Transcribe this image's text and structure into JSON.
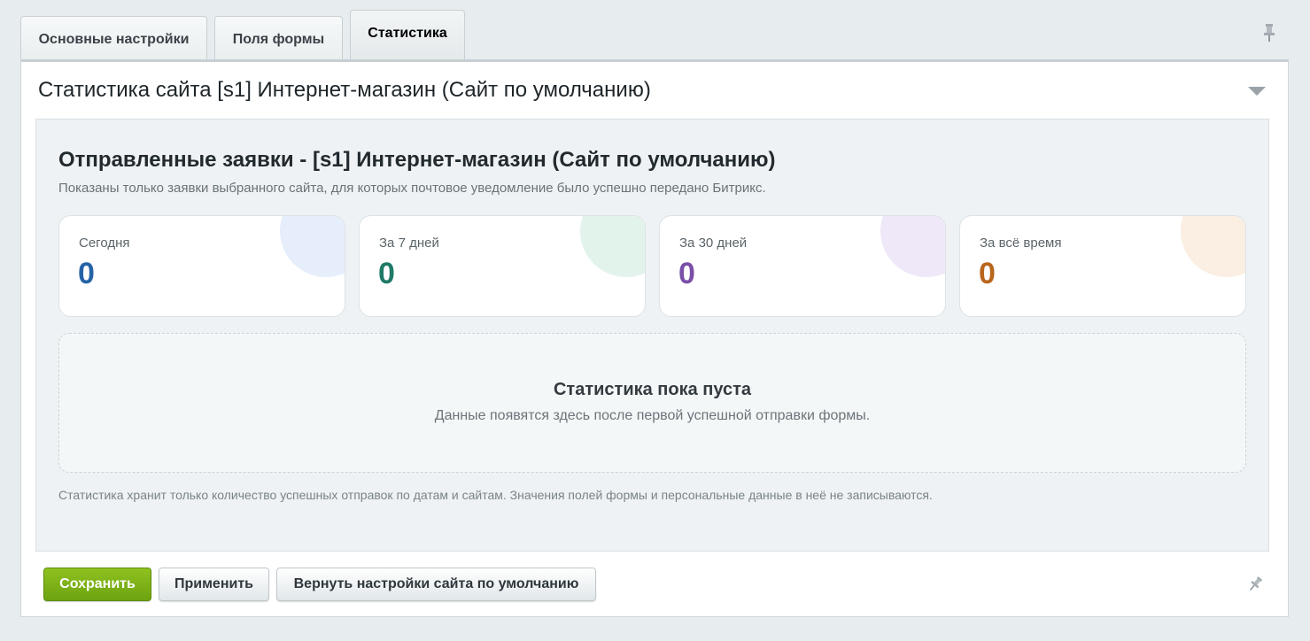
{
  "tabs": [
    {
      "label": "Основные настройки"
    },
    {
      "label": "Поля формы"
    },
    {
      "label": "Статистика",
      "active": true
    }
  ],
  "section": {
    "title": "Статистика сайта [s1] Интернет-магазин (Сайт по умолчанию)"
  },
  "stats": {
    "title": "Отправленные заявки - [s1] Интернет-магазин (Сайт по умолчанию)",
    "description": "Показаны только заявки выбранного сайта, для которых почтовое уведомление было успешно передано Битрикс.",
    "cards": [
      {
        "label": "Сегодня",
        "value": "0",
        "color": "#2563a6",
        "blob": "#e6eefb"
      },
      {
        "label": "За 7 дней",
        "value": "0",
        "color": "#1f7a67",
        "blob": "#e2f3ec"
      },
      {
        "label": "За 30 дней",
        "value": "0",
        "color": "#7a4fa8",
        "blob": "#efe8f8"
      },
      {
        "label": "За всё время",
        "value": "0",
        "color": "#b8661c",
        "blob": "#fbeee2"
      }
    ],
    "empty_title": "Статистика пока пуста",
    "empty_text": "Данные появятся здесь после первой успешной отправки формы.",
    "footnote": "Статистика хранит только количество успешных отправок по датам и сайтам. Значения полей формы и персональные данные в неё не записываются."
  },
  "buttons": {
    "save": "Сохранить",
    "apply": "Применить",
    "reset": "Вернуть настройки сайта по умолчанию"
  },
  "icons": {
    "pin_top": "pin-icon",
    "pin_bottom": "pin-icon",
    "collapse": "chevron-down-icon"
  }
}
